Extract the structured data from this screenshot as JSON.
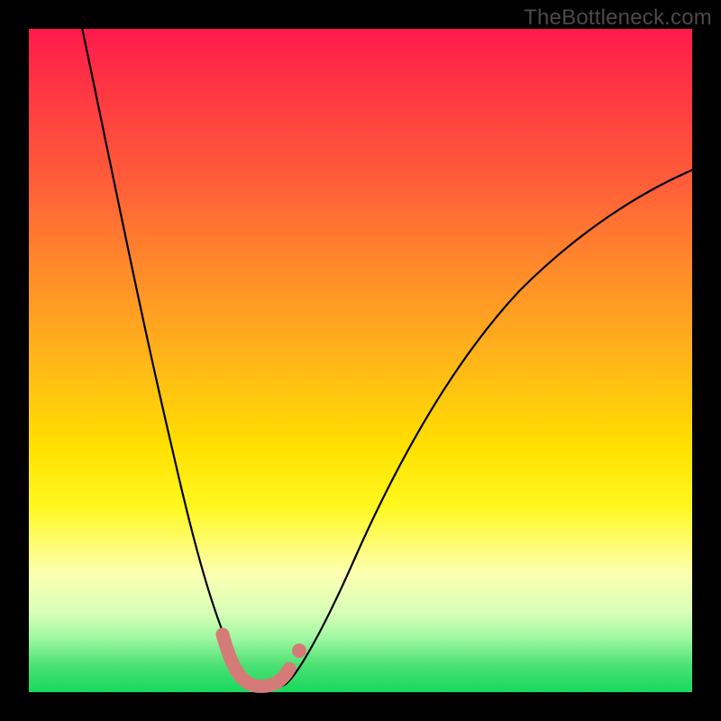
{
  "watermark": "TheBottleneck.com",
  "colors": {
    "background": "#000000",
    "curve": "#000000",
    "highlight": "#d57b77",
    "highlight_dot": "#d57b77"
  },
  "chart_data": {
    "type": "line",
    "title": "",
    "xlabel": "",
    "ylabel": "",
    "xlim": [
      0,
      100
    ],
    "ylim": [
      0,
      100
    ],
    "grid": false,
    "series": [
      {
        "name": "bottleneck-curve",
        "x": [
          5,
          10,
          15,
          20,
          24,
          27,
          29,
          31,
          33,
          35,
          38,
          42,
          46,
          50,
          55,
          60,
          66,
          74,
          84,
          96
        ],
        "values": [
          100,
          80,
          62,
          44,
          28,
          16,
          8,
          3,
          1,
          1,
          3,
          8,
          15,
          23,
          32,
          41,
          50,
          60,
          70,
          80
        ]
      }
    ],
    "annotations": [
      {
        "name": "highlight-segment",
        "x_range": [
          27,
          38
        ],
        "style": "thick-salmon"
      },
      {
        "name": "highlight-dot",
        "x": 38,
        "y": 3
      }
    ]
  }
}
